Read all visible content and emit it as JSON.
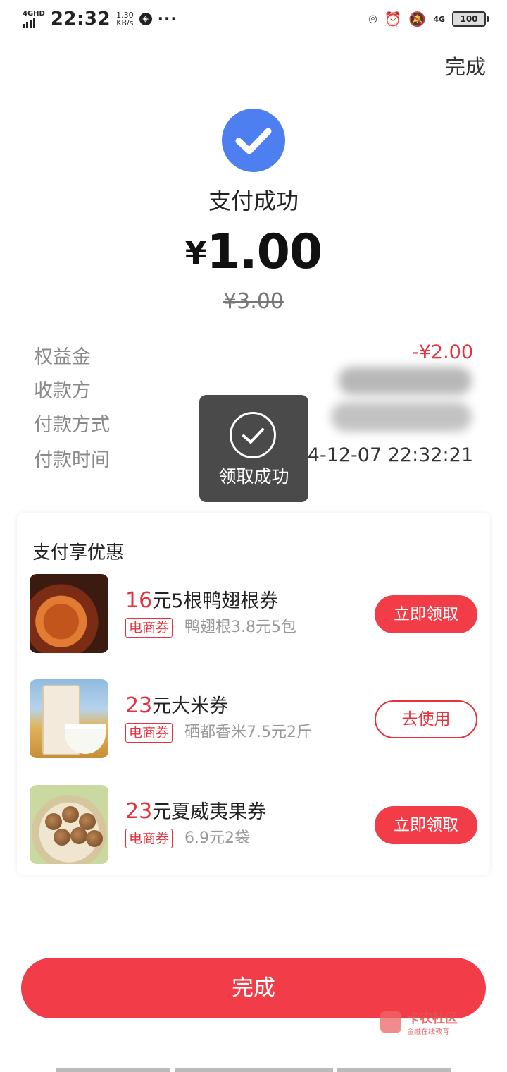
{
  "status_bar": {
    "network": "4GHD",
    "time": "22:32",
    "speed_value": "1.30",
    "speed_unit": "KB/s",
    "more": "···",
    "net_right": "4G",
    "battery": "100"
  },
  "header": {
    "done_label": "完成"
  },
  "payment": {
    "status_icon": "check-circle-icon",
    "title": "支付成功",
    "currency": "¥",
    "amount": "1.00",
    "original_amount": "¥3.00"
  },
  "details": [
    {
      "label": "权益金",
      "value": "-¥2.00"
    },
    {
      "label": "收款方",
      "value": ""
    },
    {
      "label": "付款方式",
      "value": ""
    },
    {
      "label": "付款时间",
      "value": "24-12-07 22:32:21"
    }
  ],
  "toast": {
    "icon": "check-circle-icon",
    "text": "领取成功"
  },
  "offers": {
    "title": "支付享优惠",
    "items": [
      {
        "price": "16",
        "title": "元5根鸭翅根券",
        "tag": "电商券",
        "desc": "鸭翅根3.8元5包",
        "button": "立即领取",
        "button_style": "filled"
      },
      {
        "price": "23",
        "title": "元大米券",
        "tag": "电商券",
        "desc": "硒都香米7.5元2斤",
        "button": "去使用",
        "button_style": "outline"
      },
      {
        "price": "23",
        "title": "元夏威夷果券",
        "tag": "电商券",
        "desc": "6.9元2袋",
        "button": "立即领取",
        "button_style": "filled"
      }
    ]
  },
  "footer": {
    "done_button": "完成"
  },
  "watermark": {
    "title": "卡农社区",
    "subtitle": "金融在线教育"
  },
  "colors": {
    "accent_red": "#f23c47",
    "primary_blue": "#4d7ff0",
    "toast_bg": "#4a4a4a"
  }
}
